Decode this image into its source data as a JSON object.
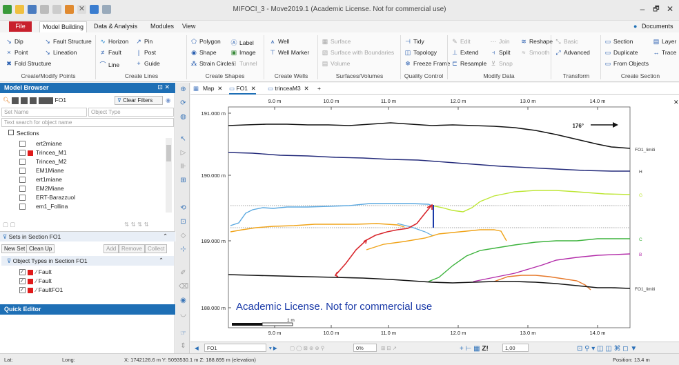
{
  "window": {
    "title": "MIFOCI_3 - Move2019.1 (Academic License. Not for commercial use)",
    "minimize": "–",
    "maximize": "🗗",
    "close": "✕"
  },
  "ribbon_tabs": {
    "file": "File",
    "tabs": [
      "Model Building",
      "Data & Analysis",
      "Modules",
      "View"
    ],
    "documents": "Documents"
  },
  "ribbon": {
    "points": {
      "dip": "Dip",
      "point": "Point",
      "fold_structure": "Fold Structure",
      "group": "Create/Modify Points"
    },
    "lines": {
      "fault_structure": "Fault Structure",
      "lineation": "Lineation",
      "horizon": "Horizon",
      "fault": "Fault",
      "line": "Line",
      "pin": "Pin",
      "post": "Post",
      "guide": "Guide",
      "group": "Create Lines"
    },
    "shapes": {
      "polygon": "Polygon",
      "shape": "Shape",
      "strain_circles": "Strain Circles",
      "label": "Label",
      "image": "Image",
      "tunnel": "Tunnel",
      "group": "Create Shapes"
    },
    "wells": {
      "well": "Well",
      "well_marker": "Well Marker",
      "group": "Create Wells"
    },
    "surfaces": {
      "surface": "Surface",
      "surface_boundaries": "Surface with Boundaries",
      "volume": "Volume",
      "group": "Surfaces/Volumes"
    },
    "quality": {
      "tidy": "Tidy",
      "topology": "Topology",
      "freeze_frame": "Freeze Frame",
      "group": "Quality Control"
    },
    "modify": {
      "edit": "Edit",
      "extend": "Extend",
      "resample": "Resample",
      "join": "Join",
      "split": "Split",
      "snap": "Snap",
      "reshape": "Reshape",
      "smooth": "Smooth",
      "group": "Modify Data"
    },
    "transform": {
      "basic": "Basic",
      "advanced": "Advanced",
      "group": "Transform"
    },
    "section": {
      "section": "Section",
      "duplicate": "Duplicate",
      "from_objects": "From Objects",
      "layer": "Layer",
      "trace": "Trace",
      "group": "Create Section"
    }
  },
  "model_browser": {
    "title": "Model Browser",
    "search_value": "FO1",
    "clear_filters": "Clear Filters",
    "set_name_placeholder": "Set Name",
    "object_type_placeholder": "Object Type",
    "object_search_placeholder": "Text search for object name",
    "sections_label": "Sections",
    "items": [
      "ert2miane",
      "Trincea_M1",
      "Trincea_M2",
      "EM1Miane",
      "ert1miane",
      "EM2Miane",
      "ERT-Barazzuol",
      "em1_Follina"
    ]
  },
  "sets_panel": {
    "title": "Sets in Section FO1",
    "new_set": "New Set",
    "clean_up": "Clean Up",
    "add": "Add",
    "remove": "Remove",
    "collect": "Collect"
  },
  "object_types": {
    "title": "Object Types in Section FO1",
    "items": [
      "Fault",
      "Fault",
      "FaultFO1"
    ]
  },
  "quick_editor": {
    "title": "Quick Editor"
  },
  "canvas_tabs": [
    {
      "label": "Map"
    },
    {
      "label": "FO1"
    },
    {
      "label": "trinceaM3"
    }
  ],
  "add_tab": "+",
  "section_view": {
    "x_ticks": [
      "9.0 m",
      "10.0 m",
      "11.0 m",
      "12.0 m",
      "13.0 m",
      "14.0 m"
    ],
    "y_ticks": [
      "191.000 m",
      "190.000 m",
      "189.000 m",
      "188.000 m"
    ],
    "azimuth": "176°",
    "watermark": "Academic License. Not for commercial use",
    "scale_label": "1 m",
    "line_labels": [
      "FO1_limiti",
      "H",
      "G",
      "C",
      "B",
      "FO1_limiti"
    ],
    "colors": {
      "black": "#111111",
      "navy": "#232a7a",
      "lime": "#bde634",
      "lightblue": "#5aa8e0",
      "orange": "#f0a318",
      "red": "#d8262c",
      "green": "#3db33d",
      "magenta": "#b22aa8",
      "darkorange": "#e6782a",
      "watermark": "#1a3aa8"
    }
  },
  "bottom_toolbar": {
    "section_select": "FO1",
    "percent": "0%",
    "zoom_value": "1,00"
  },
  "status": {
    "lat": "Lat:",
    "long": "Long:",
    "coords": "X: 1742126.6 m   Y: 5093530.1 m   Z: 188.895 m (elevation)",
    "position": "Position: 13.4 m"
  }
}
